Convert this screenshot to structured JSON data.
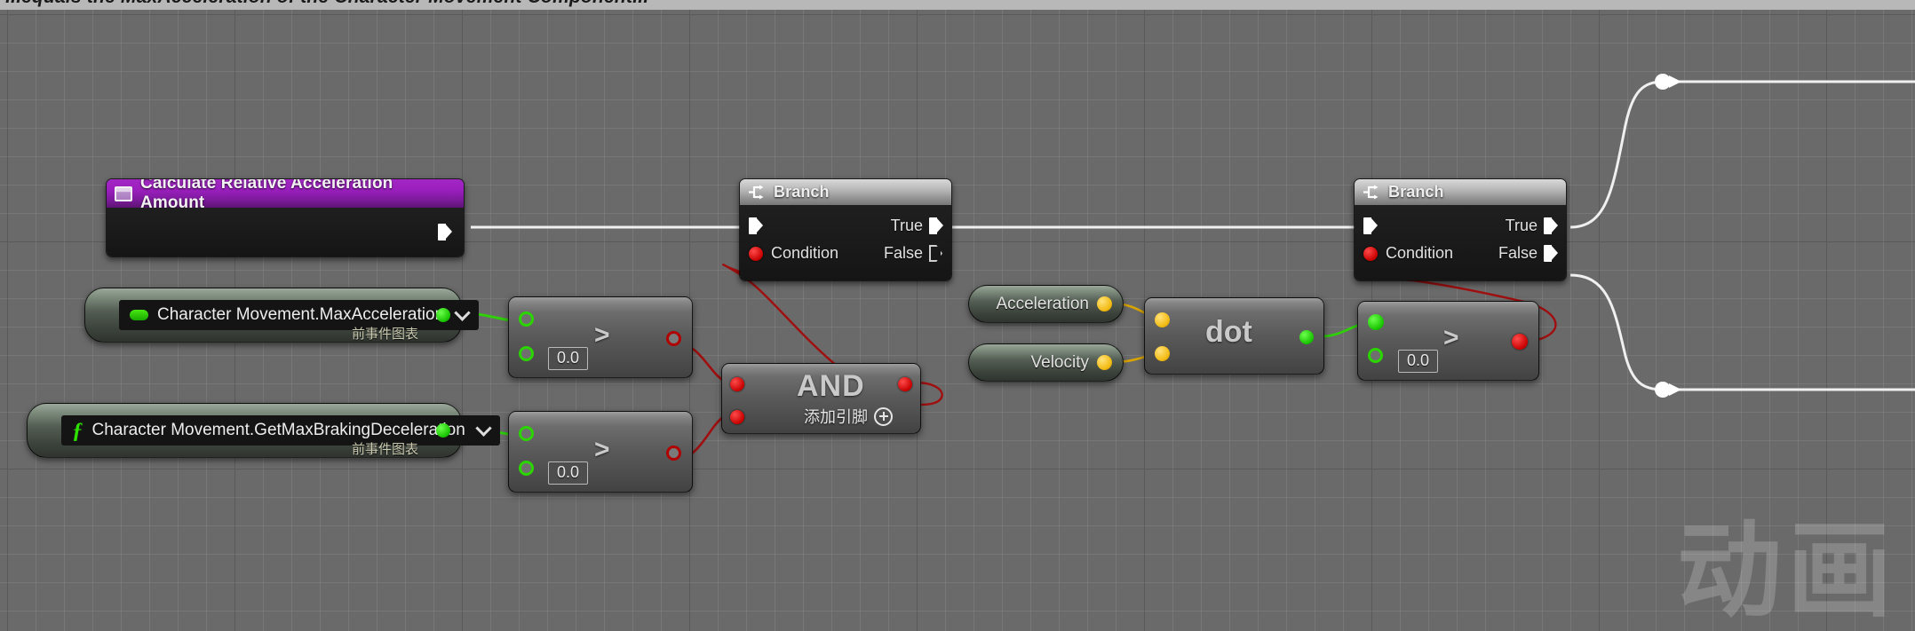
{
  "banner": {
    "text": "...equals the MaxAcceleration of the Character Movement Component..."
  },
  "watermark": "动画",
  "colors": {
    "exec_wire": "#f2f2f2",
    "bool_wire": "#a00f0f",
    "float_wire": "#2fcf0a",
    "vector_wire": "#d9a400",
    "event_title": "#9a1fbd",
    "branch_title": "#b6b6b6",
    "bool_pin": "#c70000",
    "float_pin": "#19c400",
    "vector_pin": "#f2bb13"
  },
  "nodes": {
    "calculate_event": {
      "title": "Calculate Relative Acceleration Amount",
      "icon": "material-swatch-icon",
      "exec_out": ""
    },
    "max_acceleration_getter": {
      "label": "Character Movement.MaxAcceleration",
      "subtitle": "前事件图表",
      "icon": "variable-pill-icon",
      "dropdown": "chevron-down-icon"
    },
    "braking_deceleration_getter": {
      "label": "Character Movement.GetMaxBrakingDeceleration",
      "subtitle": "前事件图表",
      "icon": "function-f-icon",
      "dropdown": "chevron-down-icon"
    },
    "greater_top": {
      "operator": ">",
      "value_b": "0.0"
    },
    "greater_bottom": {
      "operator": ">",
      "value_b": "0.0"
    },
    "and_node": {
      "operator": "AND",
      "add_pin_label": "添加引脚",
      "add_pin_icon": "plus-circle-icon"
    },
    "branch_left": {
      "title": "Branch",
      "icon": "branch-icon",
      "condition_label": "Condition",
      "true_label": "True",
      "false_label": "False"
    },
    "acceleration_getter": {
      "label": "Acceleration"
    },
    "velocity_getter": {
      "label": "Velocity"
    },
    "dot_node": {
      "operator": "dot"
    },
    "greater_right": {
      "operator": ">",
      "value_b": "0.0"
    },
    "branch_right": {
      "title": "Branch",
      "icon": "branch-icon",
      "condition_label": "Condition",
      "true_label": "True",
      "false_label": "False"
    }
  }
}
